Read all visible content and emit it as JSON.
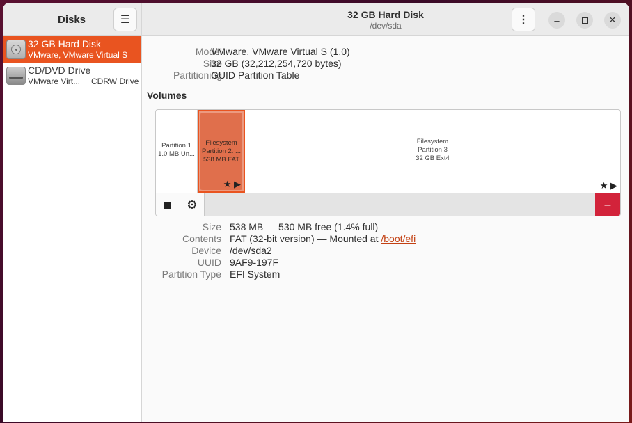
{
  "sidebar": {
    "title": "Disks",
    "menu_icon": "hamburger-menu-icon",
    "drives": [
      {
        "name": "32 GB Hard Disk",
        "sub": "VMware, VMware Virtual S",
        "icon": "hard-disk-icon",
        "selected": true
      },
      {
        "name": "CD/DVD Drive",
        "sub": "VMware Virt...",
        "sub2": "CDRW Drive",
        "icon": "optical-drive-icon",
        "selected": false
      }
    ]
  },
  "header": {
    "title": "32 GB Hard Disk",
    "subtitle": "/dev/sda",
    "more_icon": "vertical-ellipsis-icon",
    "window_controls": [
      "minimize-icon",
      "maximize-icon",
      "close-icon"
    ]
  },
  "disk": {
    "model_label": "Model",
    "model_value": "VMware, VMware Virtual S (1.0)",
    "size_label": "Size",
    "size_value": "32 GB (32,212,254,720 bytes)",
    "partitioning_label": "Partitioning",
    "partitioning_value": "GUID Partition Table"
  },
  "volumes": {
    "title": "Volumes",
    "partitions": [
      {
        "line1": "Partition 1",
        "line2": "1.0 MB Un..."
      },
      {
        "line1": "Filesystem",
        "line2": "Partition 2: ...",
        "line3": "538 MB FAT",
        "selected": true
      },
      {
        "line1": "Filesystem",
        "line2": "Partition 3",
        "line3": "32 GB Ext4"
      }
    ],
    "toolbar": {
      "stop_icon": "stop-icon",
      "settings_icon": "gear-icon",
      "delete_icon": "minus-icon",
      "delete_glyph": "–"
    }
  },
  "details": {
    "size_label": "Size",
    "size_value": "538 MB — 530 MB free (1.4% full)",
    "contents_label": "Contents",
    "contents_value": "FAT (32-bit version) — Mounted at ",
    "contents_link": "/boot/efi",
    "device_label": "Device",
    "device_value": "/dev/sda2",
    "uuid_label": "UUID",
    "uuid_value": "9AF9-197F",
    "ptype_label": "Partition Type",
    "ptype_value": "EFI System"
  },
  "colors": {
    "accent": "#e95420",
    "destructive": "#d2233a"
  }
}
